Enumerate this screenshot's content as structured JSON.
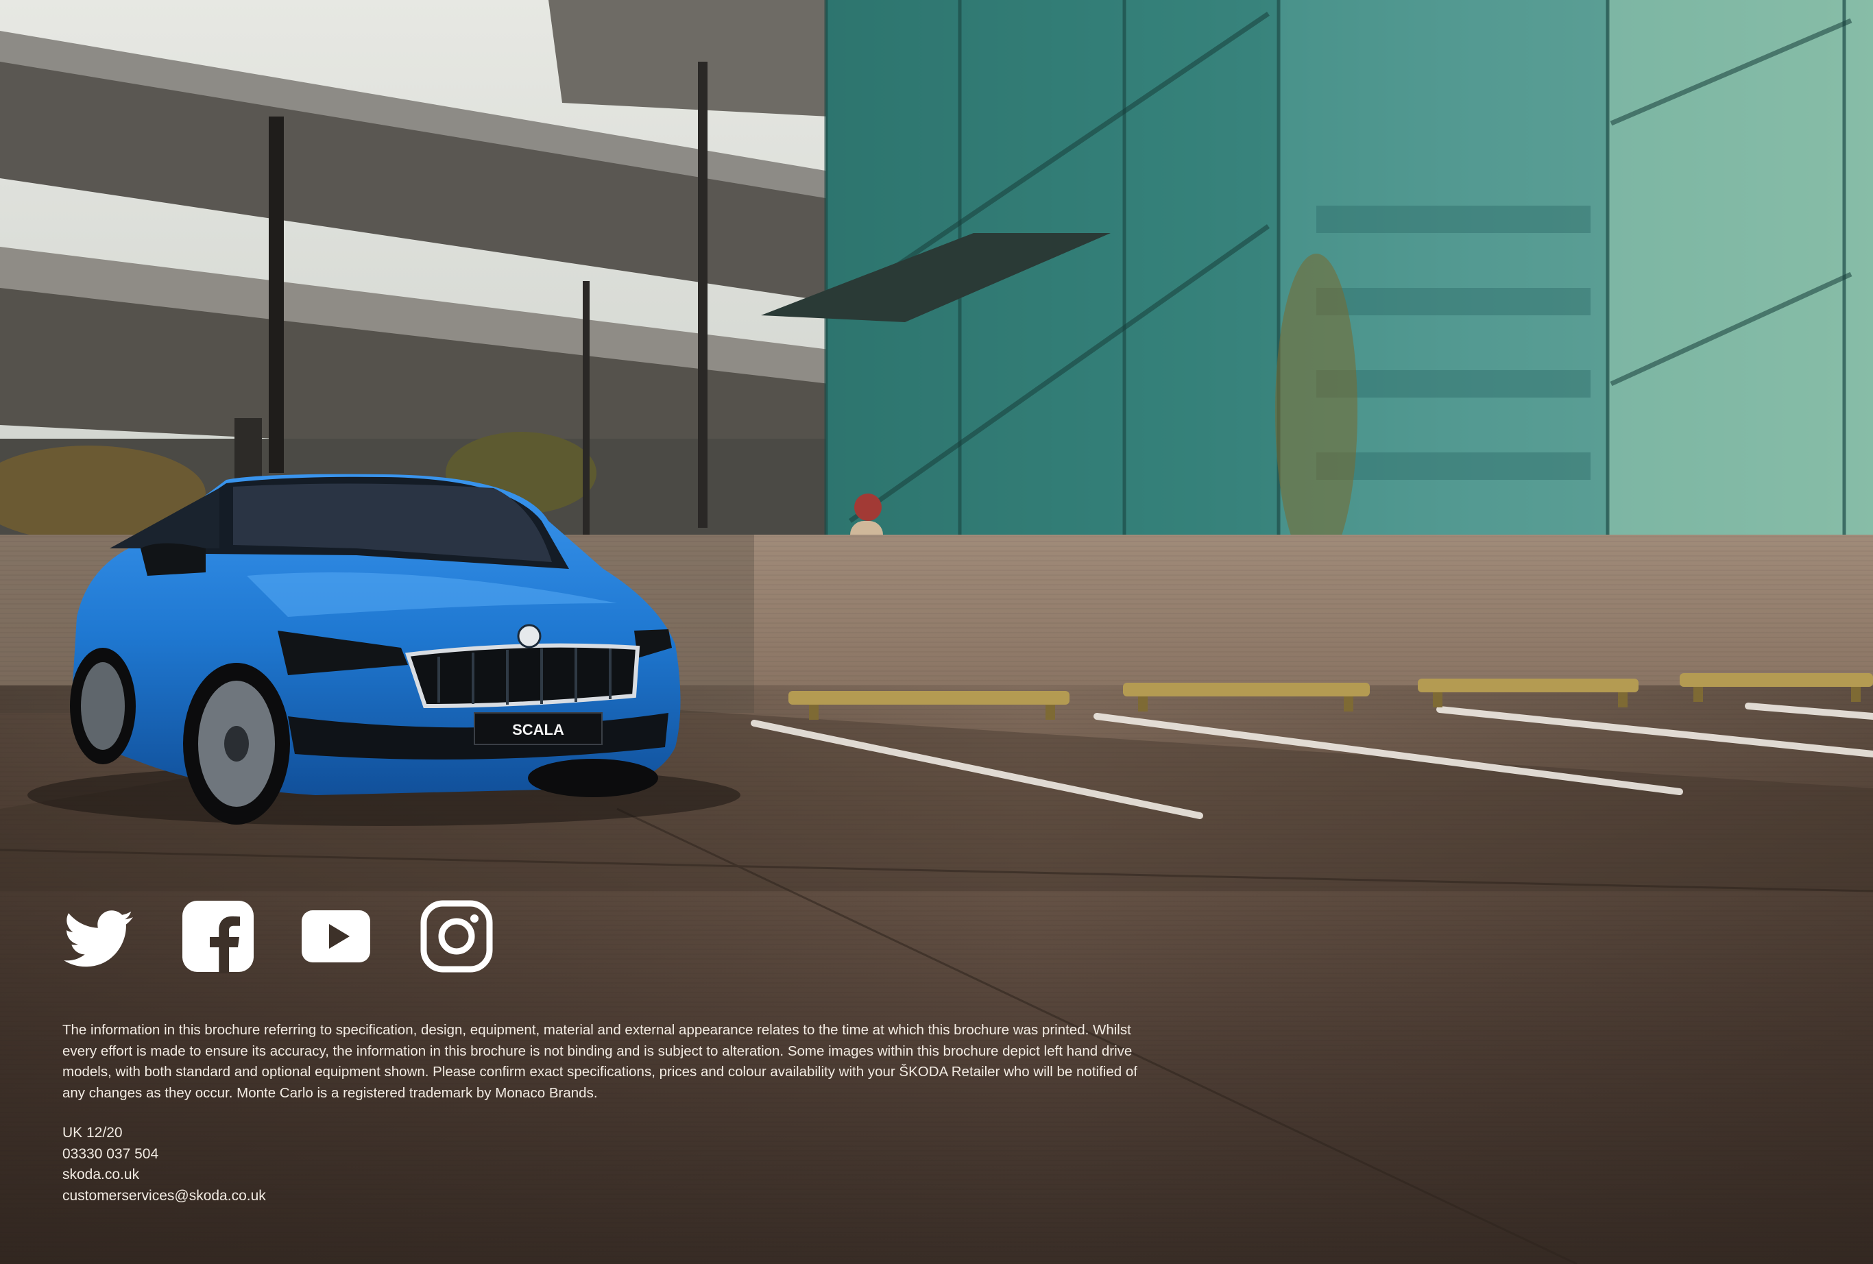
{
  "brochure": {
    "model_badge": "SCALA",
    "disclaimer": "The information in this brochure referring to specification, design, equipment, material and external appearance relates to the time at which this brochure was printed. Whilst every effort is made to ensure its accuracy, the information in this brochure is not binding and is subject to alteration. Some images within this brochure depict left hand drive models, with both standard and optional equipment shown. Please confirm exact specifications, prices and colour availability with your ŠKODA Retailer who will be notified of any changes as they occur. Monte Carlo is a registered trademark by Monaco Brands.",
    "contact": {
      "edition": "UK 12/20",
      "phone": "03330 037 504",
      "website": "skoda.co.uk",
      "email": "customerservices@skoda.co.uk"
    }
  },
  "social": [
    {
      "icon": "twitter-icon"
    },
    {
      "icon": "facebook-icon"
    },
    {
      "icon": "youtube-icon"
    },
    {
      "icon": "instagram-icon"
    }
  ],
  "colors": {
    "car_body": "#1f78d1",
    "text": "#f2ebe3",
    "glass": "#3f9f96",
    "concrete": "#8a7566"
  }
}
